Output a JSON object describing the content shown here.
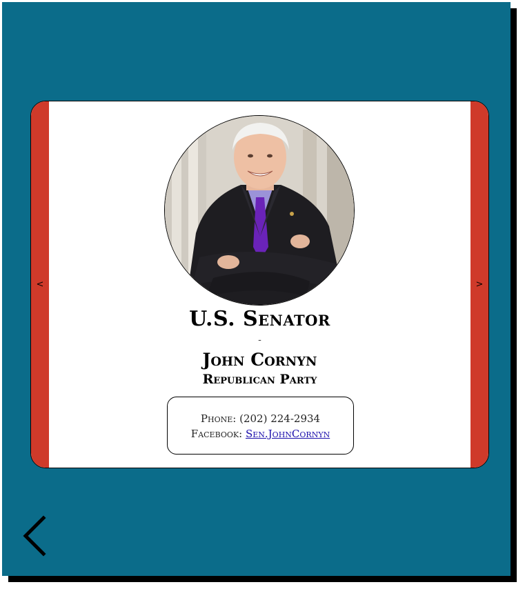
{
  "card": {
    "prev_label": "<",
    "next_label": ">",
    "role": "U.S. Senator",
    "separator": "-",
    "name": "John Cornyn",
    "party": "Republican Party",
    "phone_label": "Phone:",
    "phone_value": "(202) 224-2934",
    "facebook_label": "Facebook:",
    "facebook_link": "Sen.JohnCornyn"
  },
  "icons": {
    "back": "chevron-left-icon"
  },
  "colors": {
    "background": "#0b6c8a",
    "side_bars": "#cf3a2a",
    "card": "#ffffff"
  }
}
